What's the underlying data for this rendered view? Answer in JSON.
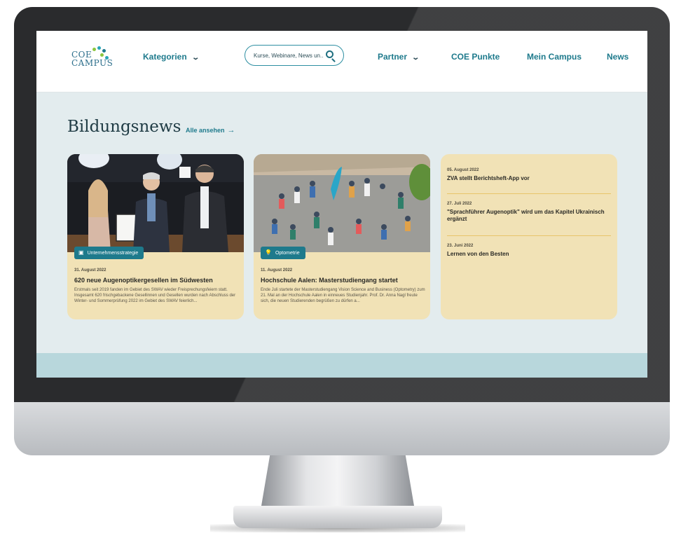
{
  "header": {
    "logo_line1": "COE",
    "logo_line2": "CAMPUS",
    "nav": {
      "kategorien": "Kategorien",
      "partner": "Partner",
      "coe_punkte": "COE Punkte",
      "mein_campus": "Mein Campus",
      "news": "News"
    },
    "search_placeholder": "Kurse, Webinare, News un..."
  },
  "section": {
    "title": "Bildungsnews",
    "see_all": "Alle ansehen",
    "see_all_arrow": "→"
  },
  "cards": [
    {
      "tag": "Unternehmensstrategie",
      "tag_icon": "store-icon",
      "date": "31. August 2022",
      "title": "620 neue Augenoptikergesellen im Südwesten",
      "text": "Erstmals seit 2019 fanden im Gebiet des SWAV wieder Freisprechungsfeiern statt. Insgesamt 620 frischgebackene Gesellinnen und Gesellen wurden nach Abschluss der Winter- und Sommerprüfung 2022 im Gebiet des SWAV feierlich..."
    },
    {
      "tag": "Optometrie",
      "tag_icon": "lightbulb-icon",
      "date": "11. August 2022",
      "title": "Hochschule Aalen: Masterstudiengang startet",
      "text": "Ende Juli startete der Masterstudiengang Vision Science and Business (Optometry) zum 21. Mal an der Hochschule Aalen in einneues Studienjahr. Prof. Dr. Anna Nagl freute sich, die neuen Studierenden begrüßen zu dürfen a..."
    }
  ],
  "sidebar_news": [
    {
      "date": "05. August 2022",
      "title": "ZVA stellt Berichtsheft-App vor"
    },
    {
      "date": "27. Juli 2022",
      "title": "\"Sprachführer Augenoptik\" wird um das Kapitel Ukrainisch ergänzt"
    },
    {
      "date": "23. Juni 2022",
      "title": "Lernen von den Besten"
    }
  ],
  "colors": {
    "accent": "#1e7a8c",
    "card_bg": "#f1e2b6",
    "page_bg": "#e3ecee",
    "bottom_band": "#b8d7dc"
  }
}
